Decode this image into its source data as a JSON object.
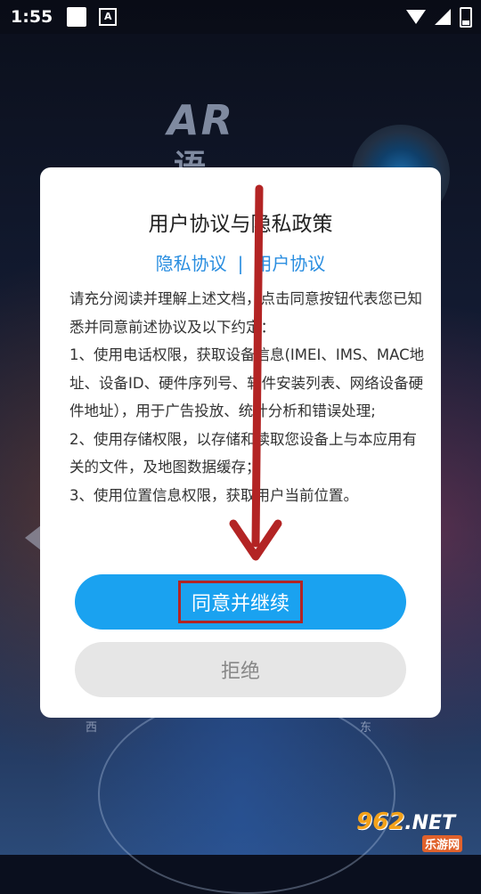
{
  "status_bar": {
    "time": "1:55",
    "icons": [
      "square-notification-icon",
      "text-a-icon",
      "wifi-icon",
      "signal-icon",
      "battery-icon"
    ]
  },
  "background": {
    "logo_text": "AR",
    "logo_sub": "语",
    "compass_west": "西",
    "compass_east": "东"
  },
  "dialog": {
    "title": "用户协议与隐私政策",
    "link_privacy": "隐私协议",
    "link_separator": "|",
    "link_user": "用户协议",
    "body": [
      "请充分阅读并理解上述文档，点击同意按钮代表您已知悉并同意前述协议及以下约定：",
      "1、使用电话权限，获取设备信息(IMEI、IMS、MAC地址、设备ID、硬件序列号、软件安装列表、网络设备硬件地址），用于广告投放、统计分析和错误处理;",
      "2、使用存储权限，以存储和读取您设备上与本应用有关的文件，及地图数据缓存；",
      "3、使用位置信息权限，获取用户当前位置。"
    ],
    "agree_button": "同意并继续",
    "reject_button": "拒绝"
  },
  "colors": {
    "accent": "#1aa2f0",
    "link": "#2a8ee0",
    "annotation_red": "#b32424",
    "reject_bg": "#e6e6e6"
  },
  "watermark": {
    "number": "962",
    "domain": ".NET",
    "sub": "乐游网"
  }
}
